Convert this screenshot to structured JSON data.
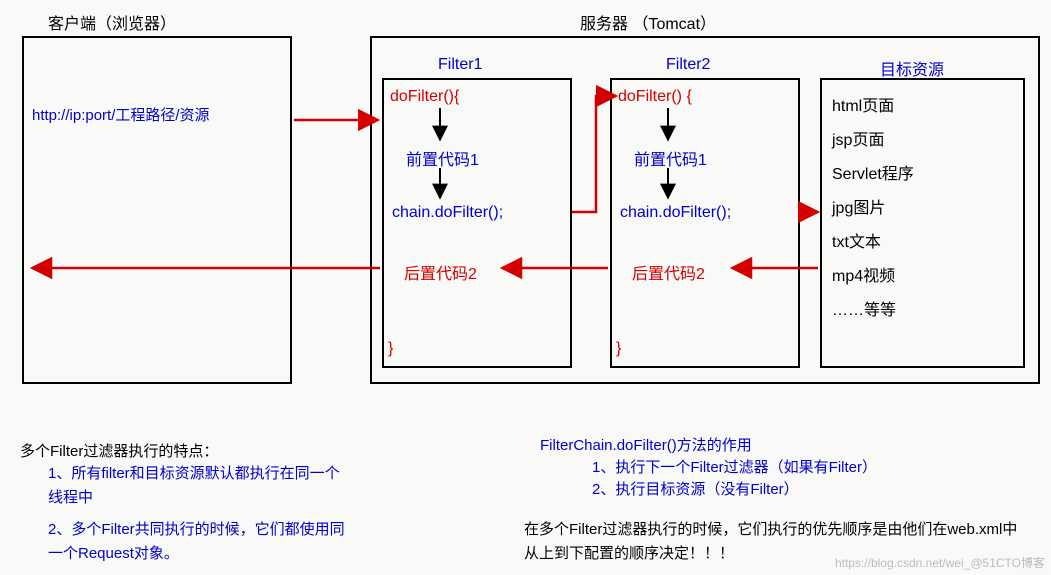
{
  "header": {
    "client_label": "客户端（浏览器）",
    "server_label": "服务器   （Tomcat）"
  },
  "client": {
    "url": "http://ip:port/工程路径/资源"
  },
  "filter1": {
    "title": "Filter1",
    "do_open": "doFilter(){",
    "pre": "前置代码1",
    "chain": "chain.doFilter();",
    "post": "后置代码2",
    "close": "}"
  },
  "filter2": {
    "title": "Filter2",
    "do_open": "doFilter() {",
    "pre": "前置代码1",
    "chain": "chain.doFilter();",
    "post": "后置代码2",
    "close": "}"
  },
  "resources": {
    "title": "目标资源",
    "items": {
      "r0": "html页面",
      "r1": "jsp页面",
      "r2": "Servlet程序",
      "r3": "jpg图片",
      "r4": "txt文本",
      "r5": "mp4视频",
      "r6": "……等等"
    }
  },
  "notes": {
    "left_title": "多个Filter过滤器执行的特点：",
    "left_1": "1、所有filter和目标资源默认都执行在同一个线程中",
    "left_2": "2、多个Filter共同执行的时候，它们都使用同一个Request对象。",
    "right_title": "FilterChain.doFilter()方法的作用",
    "right_1": "1、执行下一个Filter过滤器（如果有Filter）",
    "right_2": "2、执行目标资源（没有Filter）",
    "right_bottom": "在多个Filter过滤器执行的时候，它们执行的优先顺序是由他们在web.xml中从上到下配置的顺序决定！！！"
  },
  "watermark": "https://blog.csdn.net/wei_@51CTO博客"
}
